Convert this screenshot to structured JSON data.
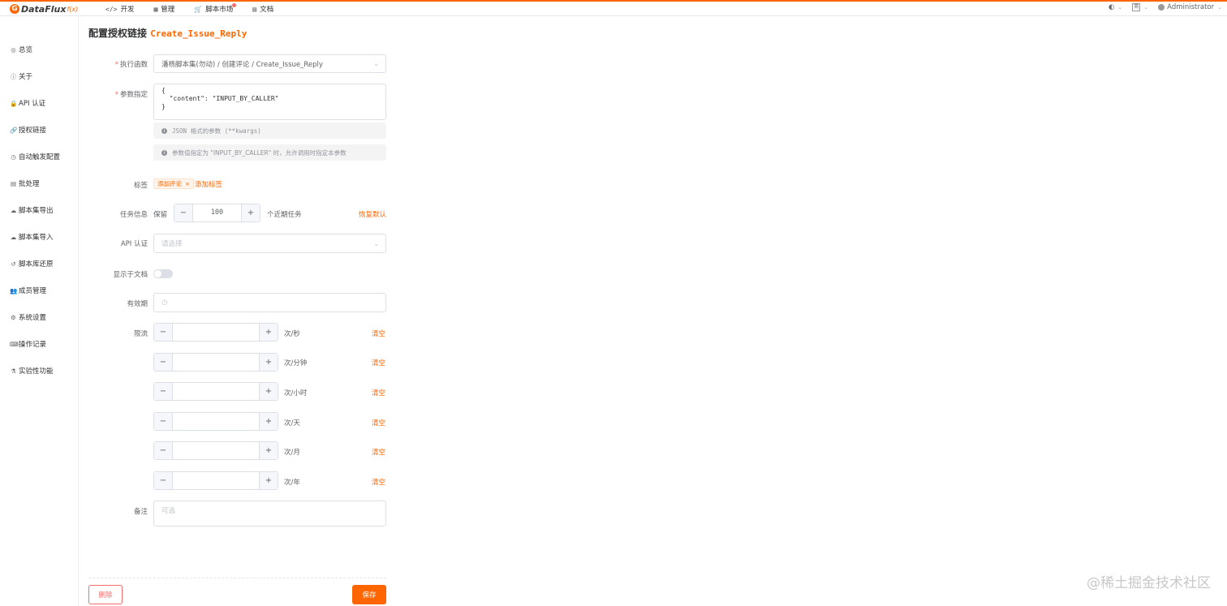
{
  "app": {
    "name": "DataFlux",
    "name_suffix": "f(x)",
    "logo_letter": "G"
  },
  "topnav": [
    {
      "icon": "</>",
      "label": "开发"
    },
    {
      "icon": "▦",
      "label": "管理"
    },
    {
      "icon": "🛒",
      "label": "脚本市场",
      "has_badge": true
    },
    {
      "icon": "▤",
      "label": "文档"
    }
  ],
  "topright": {
    "lang": "简",
    "user": "Administrator"
  },
  "sidebar": {
    "items": [
      {
        "icon": "◎",
        "label": "总览"
      },
      {
        "icon": "ⓘ",
        "label": "关于"
      },
      {
        "icon": "🔒",
        "label": "API 认证"
      },
      {
        "icon": "🔗",
        "label": "授权链接"
      },
      {
        "icon": "◷",
        "label": "自动触发配置"
      },
      {
        "icon": "▤",
        "label": "批处理"
      },
      {
        "icon": "☁",
        "label": "脚本集导出"
      },
      {
        "icon": "☁",
        "label": "脚本集导入"
      },
      {
        "icon": "↺",
        "label": "脚本库还原"
      },
      {
        "icon": "👥",
        "label": "成员管理"
      },
      {
        "icon": "⚙",
        "label": "系统设置"
      },
      {
        "icon": "⌨",
        "label": "操作记录"
      },
      {
        "icon": "⚗",
        "label": "实验性功能"
      }
    ]
  },
  "page": {
    "title": "配置授权链接",
    "title_code": "Create_Issue_Reply"
  },
  "form": {
    "func": {
      "label": "执行函数",
      "value": "潘杨脚本集(勿动) / 创建评论 / Create_Issue_Reply"
    },
    "args": {
      "label": "参数指定",
      "code": "{\n  \"content\": \"INPUT_BY_CALLER\"\n}",
      "hint1": "JSON 格式的参数 (**kwargs)",
      "hint2": "参数值指定为 \"INPUT_BY_CALLER\" 时，允许调用时指定本参数"
    },
    "tags": {
      "label": "标签",
      "items": [
        "添加评论"
      ],
      "add_label": "添加标签"
    },
    "task": {
      "label": "任务信息",
      "prefix": "保留",
      "value": "100",
      "suffix": "个近期任务",
      "reset": "恢复默认"
    },
    "api_auth": {
      "label": "API 认证",
      "placeholder": "请选择"
    },
    "show_in_doc": {
      "label": "显示于文档",
      "enabled": false
    },
    "expire": {
      "label": "有效期"
    },
    "throttling": {
      "label": "限流",
      "clear_label": "清空",
      "units": [
        "次/秒",
        "次/分钟",
        "次/小时",
        "次/天",
        "次/月",
        "次/年"
      ]
    },
    "note": {
      "label": "备注",
      "placeholder": "可选"
    }
  },
  "actions": {
    "delete": "删除",
    "save": "保存"
  },
  "watermark": "@稀土掘金技术社区",
  "colors": {
    "accent": "#ff6600",
    "danger": "#f56c6c",
    "border": "#dcdfe6"
  }
}
